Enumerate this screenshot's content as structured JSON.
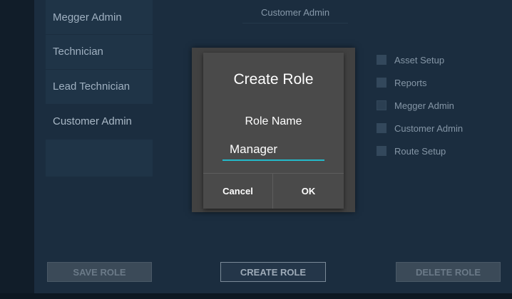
{
  "roles": [
    "Megger Admin",
    "Technician",
    "Lead Technician",
    "Customer Admin",
    ""
  ],
  "selected_role_header": "Customer Admin",
  "permissions": [
    {
      "label": "Asset Setup",
      "checked": true
    },
    {
      "label": "Reports",
      "checked": true
    },
    {
      "label": "Megger Admin",
      "checked": false
    },
    {
      "label": "Customer Admin",
      "checked": true
    },
    {
      "label": "Route Setup",
      "checked": true
    }
  ],
  "dialog": {
    "title": "Create Role",
    "field_label": "Role Name",
    "input_value": "Manager",
    "cancel_label": "Cancel",
    "ok_label": "OK"
  },
  "buttons": {
    "save": "SAVE ROLE",
    "create": "CREATE ROLE",
    "delete": "DELETE ROLE"
  },
  "colors": {
    "accent": "#23b9c9",
    "background": "#1b2d3f",
    "dialog": "#4a4a4a"
  }
}
